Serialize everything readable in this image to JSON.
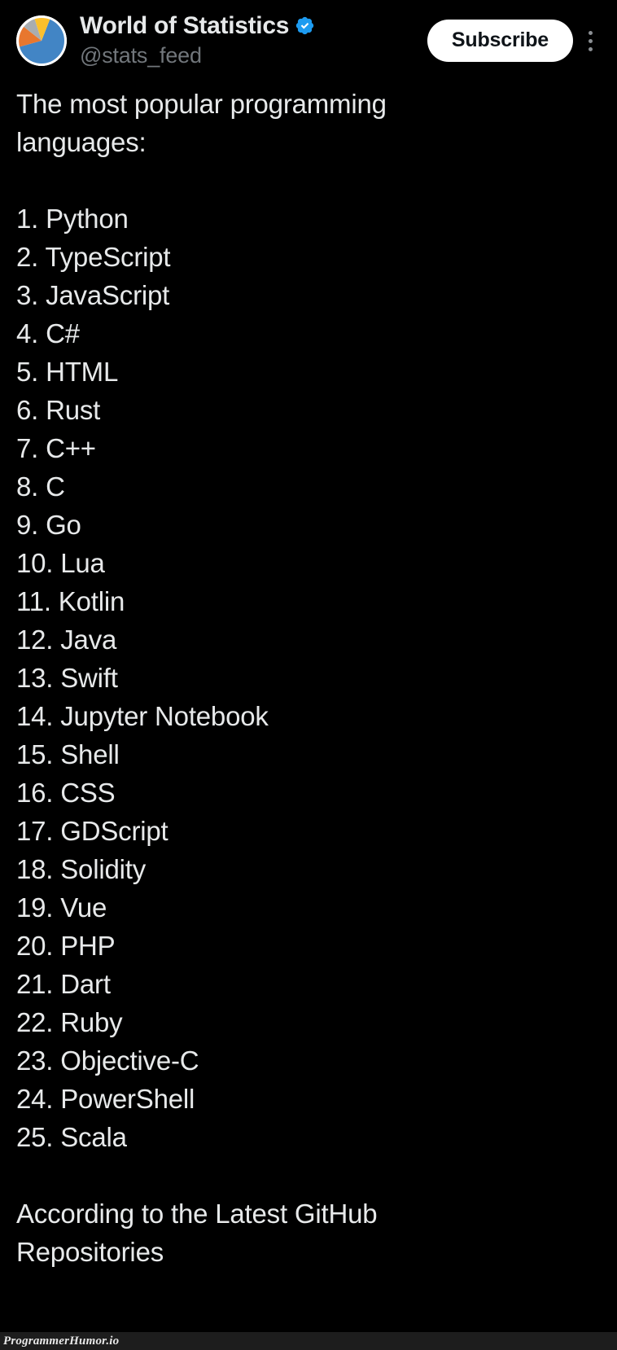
{
  "colors": {
    "background": "#000000",
    "text_primary": "#e7e9ea",
    "text_muted": "#71767b",
    "verified_blue": "#1d9bf0",
    "button_bg": "#ffffff",
    "button_text": "#0f1419",
    "watermark_bar": "#1d1d1d",
    "pie_blue": "#4285c5",
    "pie_orange": "#e8772e",
    "pie_gray": "#a9adb1",
    "pie_yellow": "#fbc02d"
  },
  "header": {
    "avatar_icon": "pie-chart-avatar",
    "display_name": "World of Statistics",
    "verified_icon": "verified-badge-icon",
    "handle": "@stats_feed",
    "subscribe_label": "Subscribe",
    "more_icon": "more-vertical-icon"
  },
  "tweet": {
    "lines": [
      "The most popular programming",
      "languages:",
      "",
      "1. Python",
      "2. TypeScript",
      "3. JavaScript",
      "4. C#",
      "5. HTML",
      "6. Rust",
      "7. C++",
      "8. C",
      "9. Go",
      "10. Lua",
      "11. Kotlin",
      "12. Java",
      "13. Swift",
      "14. Jupyter Notebook",
      "15. Shell",
      "16. CSS",
      "17. GDScript",
      "18. Solidity",
      "19. Vue",
      "20. PHP",
      "21. Dart",
      "22. Ruby",
      "23. Objective-C",
      "24. PowerShell",
      "25. Scala",
      "",
      "According to the Latest GitHub",
      "Repositories"
    ],
    "heading": "The most popular programming languages:",
    "ranking": [
      {
        "rank": "1.",
        "language": "Python"
      },
      {
        "rank": "2.",
        "language": "TypeScript"
      },
      {
        "rank": "3.",
        "language": "JavaScript"
      },
      {
        "rank": "4.",
        "language": "C#"
      },
      {
        "rank": "5.",
        "language": "HTML"
      },
      {
        "rank": "6.",
        "language": "Rust"
      },
      {
        "rank": "7.",
        "language": "C++"
      },
      {
        "rank": "8.",
        "language": "C"
      },
      {
        "rank": "9.",
        "language": "Go"
      },
      {
        "rank": "10.",
        "language": "Lua"
      },
      {
        "rank": "11.",
        "language": "Kotlin"
      },
      {
        "rank": "12.",
        "language": "Java"
      },
      {
        "rank": "13.",
        "language": "Swift"
      },
      {
        "rank": "14.",
        "language": "Jupyter Notebook"
      },
      {
        "rank": "15.",
        "language": "Shell"
      },
      {
        "rank": "16.",
        "language": "CSS"
      },
      {
        "rank": "17.",
        "language": "GDScript"
      },
      {
        "rank": "18.",
        "language": "Solidity"
      },
      {
        "rank": "19.",
        "language": "Vue"
      },
      {
        "rank": "20.",
        "language": "PHP"
      },
      {
        "rank": "21.",
        "language": "Dart"
      },
      {
        "rank": "22.",
        "language": "Ruby"
      },
      {
        "rank": "23.",
        "language": "Objective-C"
      },
      {
        "rank": "24.",
        "language": "PowerShell"
      },
      {
        "rank": "25.",
        "language": "Scala"
      }
    ],
    "footer_note": "According to the Latest GitHub Repositories"
  },
  "watermark": {
    "text": "ProgrammerHumor.io"
  }
}
